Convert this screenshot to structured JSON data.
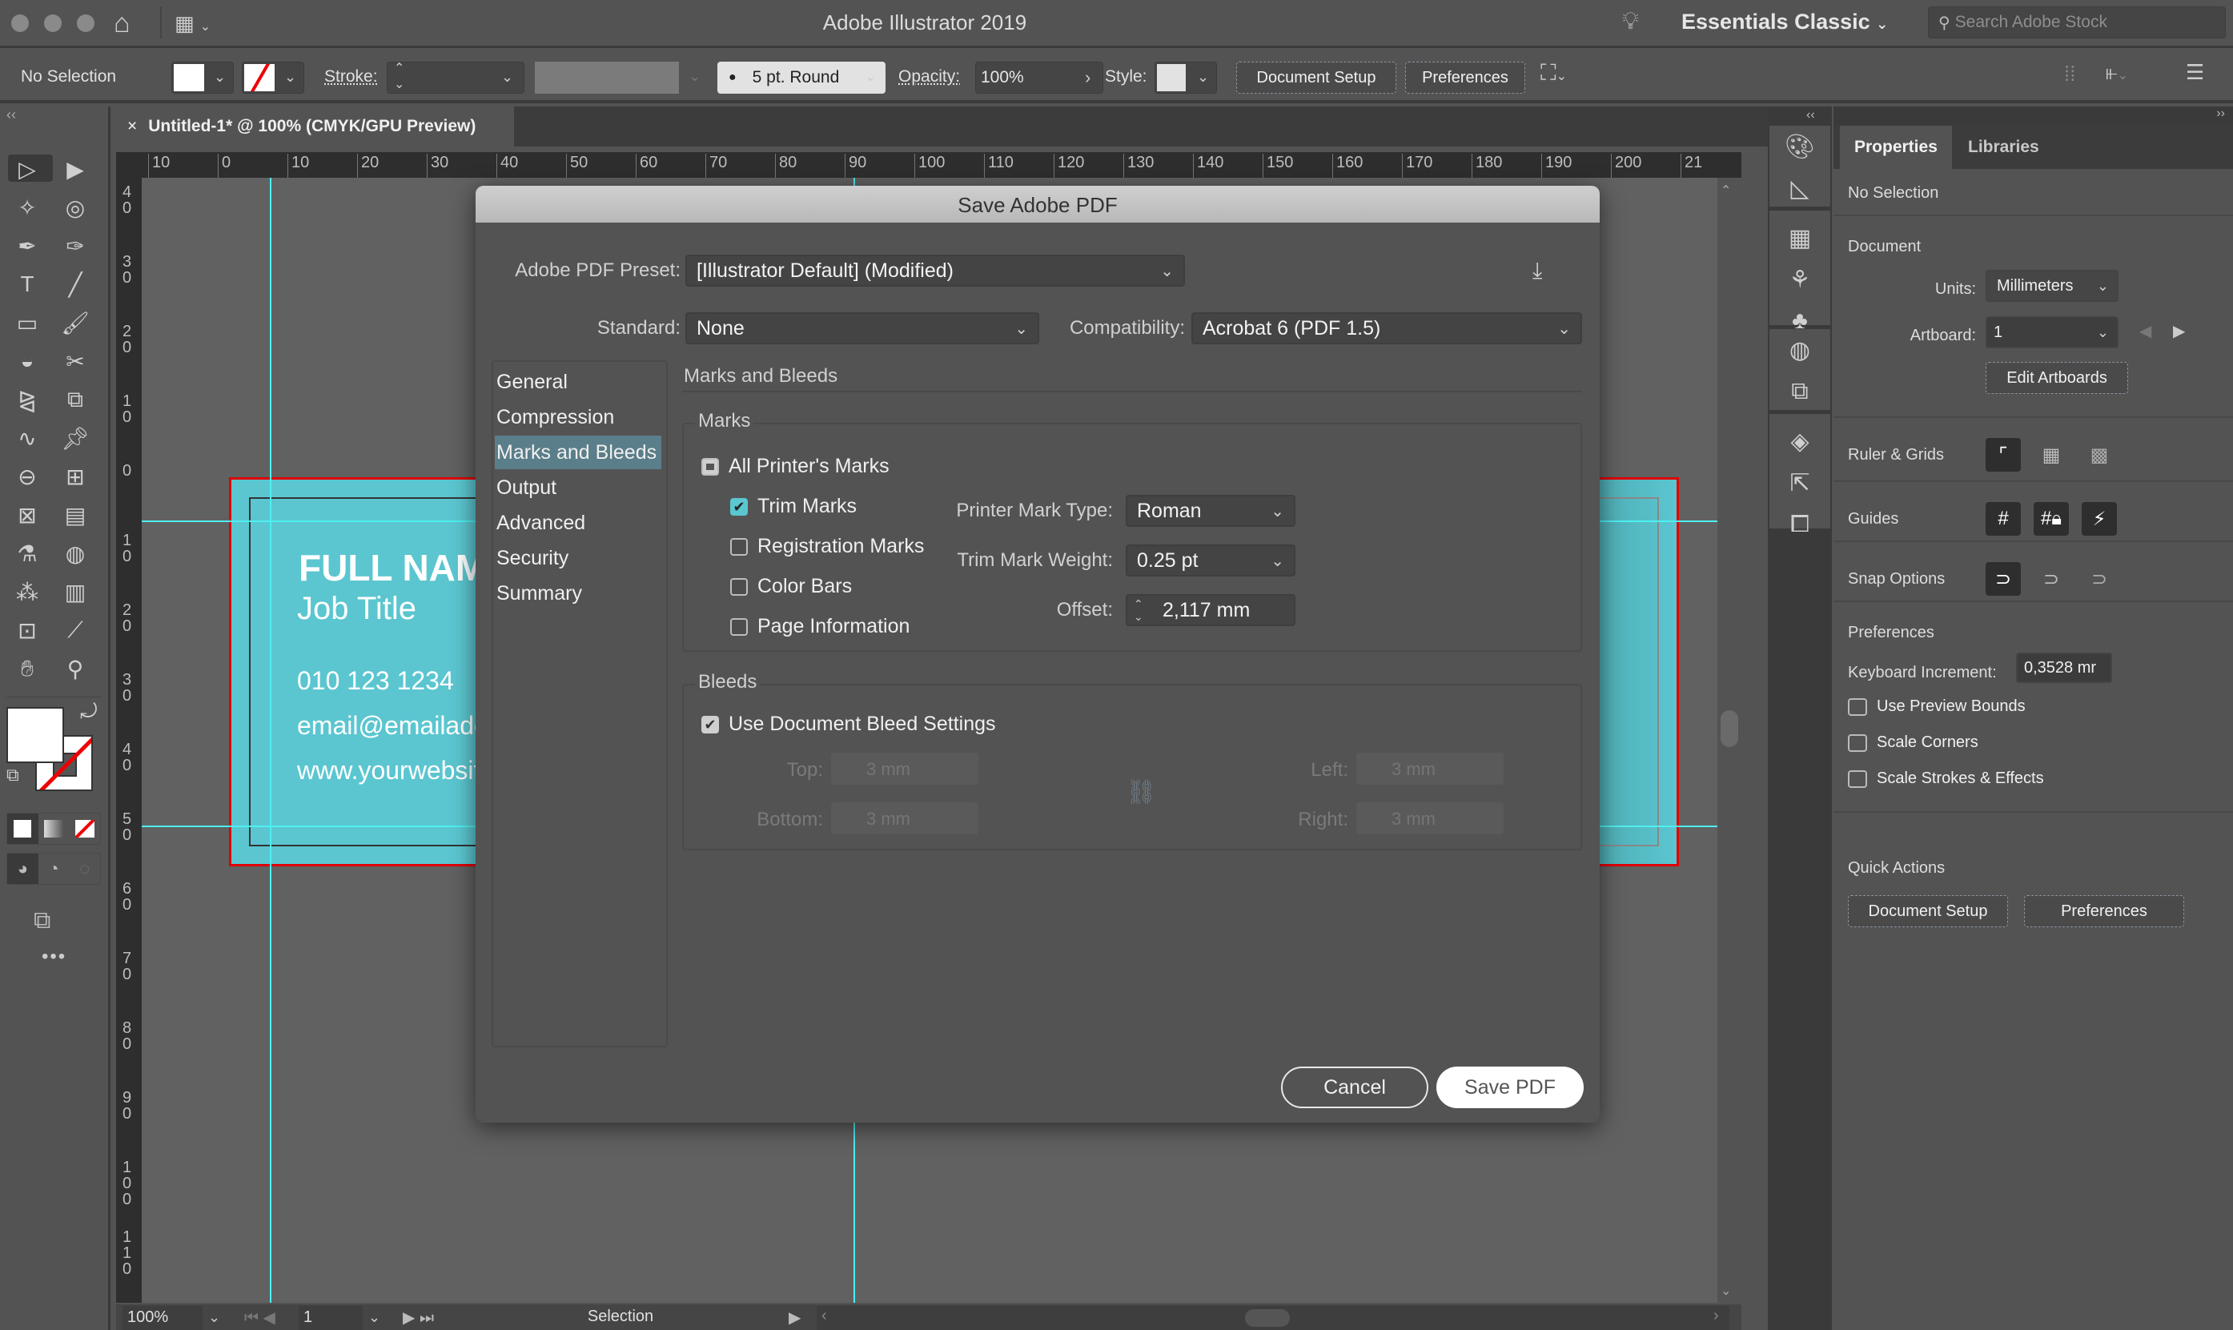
{
  "titlebar": {
    "app_title": "Adobe Illustrator 2019",
    "workspace": "Essentials Classic",
    "search_placeholder": "Search Adobe Stock"
  },
  "controlbar": {
    "selection_status": "No Selection",
    "stroke_label": "Stroke:",
    "brush_value": "5 pt. Round",
    "opacity_label": "Opacity:",
    "opacity_value": "100%",
    "style_label": "Style:",
    "document_setup": "Document Setup",
    "preferences": "Preferences"
  },
  "document_tab": {
    "title": "Untitled-1* @ 100% (CMYK/GPU Preview)",
    "close": "×"
  },
  "rulers": {
    "horizontal": [
      "10",
      "0",
      "10",
      "20",
      "30",
      "40",
      "50",
      "60",
      "70",
      "80",
      "90",
      "100",
      "110",
      "120",
      "130",
      "140",
      "150",
      "160",
      "170",
      "180",
      "190",
      "200",
      "21"
    ],
    "vertical": [
      "40",
      "30",
      "20",
      "10",
      "0",
      "10",
      "20",
      "30",
      "40",
      "50",
      "60",
      "70",
      "80",
      "90",
      "100",
      "110"
    ]
  },
  "artboard": {
    "name": "FULL NAME",
    "job_title": "Job Title",
    "phone": "010 123 1234",
    "email": "email@emailaddress.com",
    "website": "www.yourwebsite.com",
    "bg_color": "#5bc6d0",
    "bleed_color": "#e00000",
    "guide_color": "#4ef0f0"
  },
  "statusbar": {
    "zoom": "100%",
    "artboard_number": "1",
    "tool_name": "Selection"
  },
  "dialog": {
    "title": "Save Adobe PDF",
    "preset_label": "Adobe PDF Preset:",
    "preset_value": "[Illustrator Default] (Modified)",
    "standard_label": "Standard:",
    "standard_value": "None",
    "compat_label": "Compatibility:",
    "compat_value": "Acrobat 6 (PDF 1.5)",
    "nav": [
      {
        "label": "General",
        "active": false
      },
      {
        "label": "Compression",
        "active": false
      },
      {
        "label": "Marks and Bleeds",
        "active": true
      },
      {
        "label": "Output",
        "active": false
      },
      {
        "label": "Advanced",
        "active": false
      },
      {
        "label": "Security",
        "active": false
      },
      {
        "label": "Summary",
        "active": false
      }
    ],
    "section_title": "Marks and Bleeds",
    "marks": {
      "group_title": "Marks",
      "all_printers_marks": {
        "label": "All Printer's Marks",
        "state": "mixed"
      },
      "trim_marks": {
        "label": "Trim Marks",
        "checked": true
      },
      "registration_marks": {
        "label": "Registration Marks",
        "checked": false
      },
      "color_bars": {
        "label": "Color Bars",
        "checked": false
      },
      "page_information": {
        "label": "Page Information",
        "checked": false
      },
      "printer_mark_type_label": "Printer Mark Type:",
      "printer_mark_type_value": "Roman",
      "trim_mark_weight_label": "Trim Mark Weight:",
      "trim_mark_weight_value": "0.25 pt",
      "offset_label": "Offset:",
      "offset_value": "2,117 mm"
    },
    "bleeds": {
      "group_title": "Bleeds",
      "use_document_bleed": {
        "label": "Use Document Bleed Settings",
        "checked": true
      },
      "top_label": "Top:",
      "top_value": "3 mm",
      "bottom_label": "Bottom:",
      "bottom_value": "3 mm",
      "left_label": "Left:",
      "left_value": "3 mm",
      "right_label": "Right:",
      "right_value": "3 mm"
    },
    "cancel": "Cancel",
    "save": "Save PDF"
  },
  "properties_panel": {
    "tabs": [
      "Properties",
      "Libraries"
    ],
    "no_selection": "No Selection",
    "document_heading": "Document",
    "units_label": "Units:",
    "units_value": "Millimeters",
    "artboard_label": "Artboard:",
    "artboard_value": "1",
    "edit_artboards": "Edit Artboards",
    "ruler_grids": "Ruler & Grids",
    "guides": "Guides",
    "snap_options": "Snap Options",
    "preferences_heading": "Preferences",
    "keyboard_increment_label": "Keyboard Increment:",
    "keyboard_increment_value": "0,3528 mr",
    "checkboxes": [
      {
        "label": "Use Preview Bounds",
        "checked": false
      },
      {
        "label": "Scale Corners",
        "checked": false
      },
      {
        "label": "Scale Strokes & Effects",
        "checked": false
      }
    ],
    "quick_actions": "Quick Actions",
    "qa_document_setup": "Document Setup",
    "qa_preferences": "Preferences"
  }
}
